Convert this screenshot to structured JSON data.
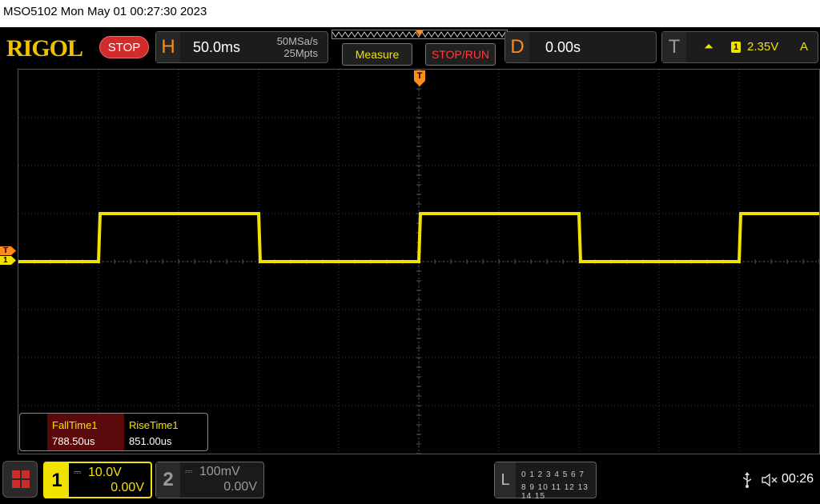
{
  "status_line": {
    "text": "MSO5102  Mon May 01 00:27:30 2023"
  },
  "header": {
    "logo": "RIGOL",
    "run_state": "STOP",
    "horizontal": {
      "letter": "H",
      "timebase": "50.0ms",
      "sample_rate": "50MSa/s",
      "memory_depth": "25Mpts"
    },
    "measure_button": "Measure",
    "stoprun_button": "STOP/RUN",
    "delay": {
      "letter": "D",
      "value": "0.00s"
    },
    "trigger": {
      "letter": "T",
      "slope_icon": "rising-edge-icon",
      "source": "1",
      "level": "2.35V",
      "mode": "A"
    }
  },
  "screen": {
    "trigger_marker": "T",
    "trigger_level_marker": "T",
    "channel1_marker": "1",
    "waveform_color": "#f2e200",
    "waveform": {
      "high_div": 1.0,
      "low_div": 0.0,
      "transitions_div": [
        1.0,
        3.0,
        5.0,
        7.0,
        9.0
      ],
      "start_level": "low"
    }
  },
  "measurements": [
    {
      "name": "FallTime1",
      "value": "788.50us"
    },
    {
      "name": "RiseTime1",
      "value": "851.00us"
    }
  ],
  "channels": [
    {
      "num": "1",
      "scale": "10.0V",
      "offset": "0.00V",
      "active": true
    },
    {
      "num": "2",
      "scale": "100mV",
      "offset": "0.00V",
      "active": false
    }
  ],
  "logic": {
    "letter": "L",
    "row1": "0 1 2 3  4 5 6 7",
    "row2": "8 9 10 11 12 13 14 15"
  },
  "status_icons": {
    "usb": "usb-icon",
    "sound": "speaker-muted-icon"
  },
  "clock": "00:26"
}
